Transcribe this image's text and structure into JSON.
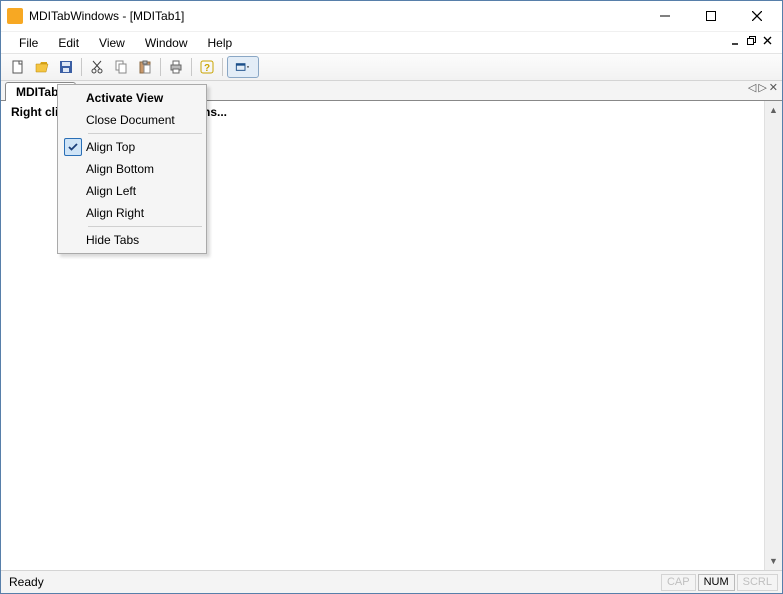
{
  "window": {
    "title": "MDITabWindows - [MDITab1]"
  },
  "menubar": {
    "file": "File",
    "edit": "Edit",
    "view": "View",
    "window": "Window",
    "help": "Help"
  },
  "tabs": {
    "active": "MDITab1"
  },
  "client": {
    "hint_visible_left": "Right c",
    "hint_visible_right": "e options...",
    "hint_full": "Right click on the tab to see options..."
  },
  "context_menu": {
    "activate_view": "Activate View",
    "close_document": "Close Document",
    "align_top": "Align Top",
    "align_bottom": "Align Bottom",
    "align_left": "Align Left",
    "align_right": "Align Right",
    "hide_tabs": "Hide Tabs",
    "checked": "align_top"
  },
  "statusbar": {
    "ready": "Ready",
    "cap": "CAP",
    "num": "NUM",
    "scrl": "SCRL"
  }
}
